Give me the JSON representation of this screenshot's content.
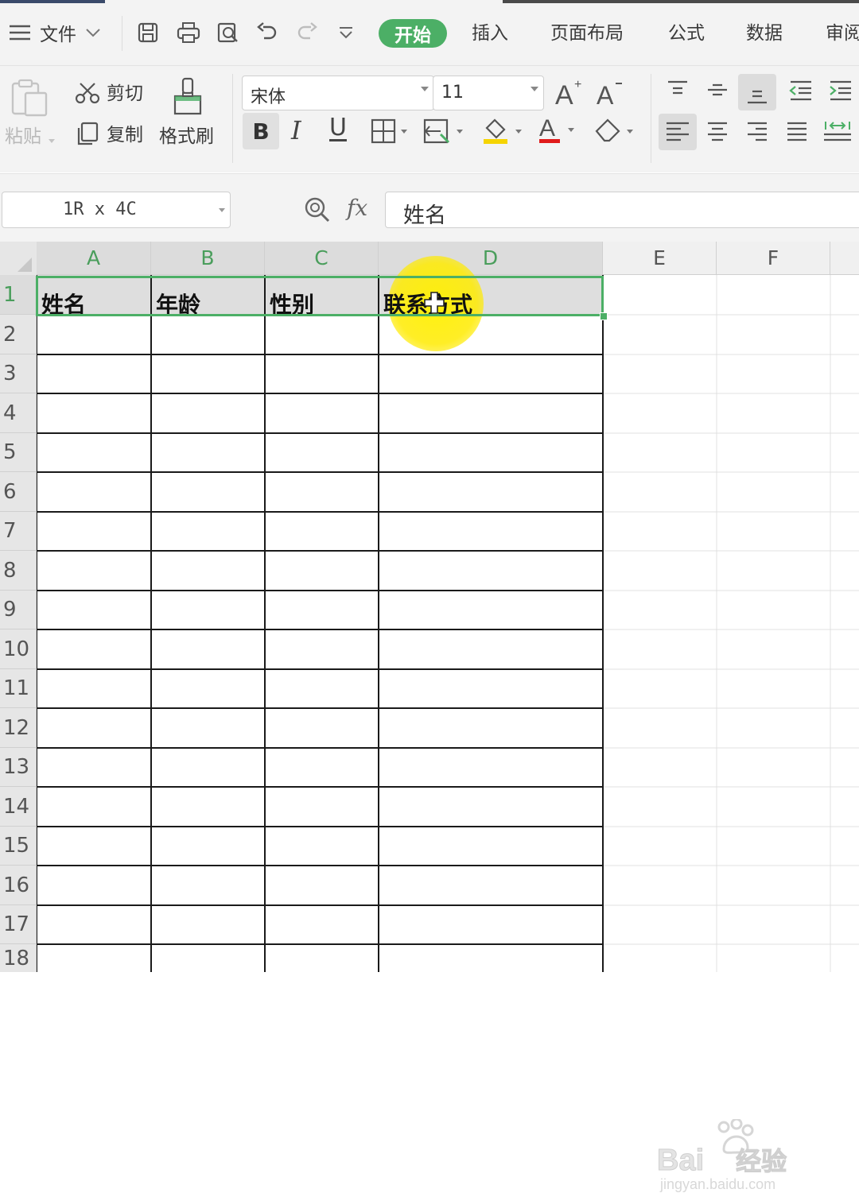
{
  "menubar": {
    "file_label": "文件",
    "tabs": [
      {
        "label": "开始",
        "active": true
      },
      {
        "label": "插入",
        "active": false
      },
      {
        "label": "页面布局",
        "active": false
      },
      {
        "label": "公式",
        "active": false
      },
      {
        "label": "数据",
        "active": false
      },
      {
        "label": "审阅",
        "active": false
      }
    ],
    "accent_color": "#4caf66"
  },
  "ribbon": {
    "paste_label": "粘贴",
    "cut_label": "剪切",
    "copy_label": "复制",
    "format_painter_label": "格式刷",
    "font_name": "宋体",
    "font_size": "11",
    "bold_label": "B",
    "italic_label": "I",
    "underline_label": "U"
  },
  "formula_bar": {
    "name_box": "1R x 4C",
    "fx_label": "fx",
    "content": "姓名"
  },
  "grid": {
    "columns": [
      "A",
      "B",
      "C",
      "D",
      "E",
      "F"
    ],
    "rows": [
      "1",
      "2",
      "3",
      "4",
      "5",
      "6",
      "7",
      "8",
      "9",
      "10",
      "11",
      "12",
      "13",
      "14",
      "15",
      "16",
      "17",
      "18"
    ],
    "header_row": [
      "姓名",
      "年龄",
      "性别",
      "联系方式"
    ]
  },
  "watermark": {
    "brand": "Bai",
    "brand_suffix": "经验",
    "url": "jingyan.baidu.com"
  }
}
